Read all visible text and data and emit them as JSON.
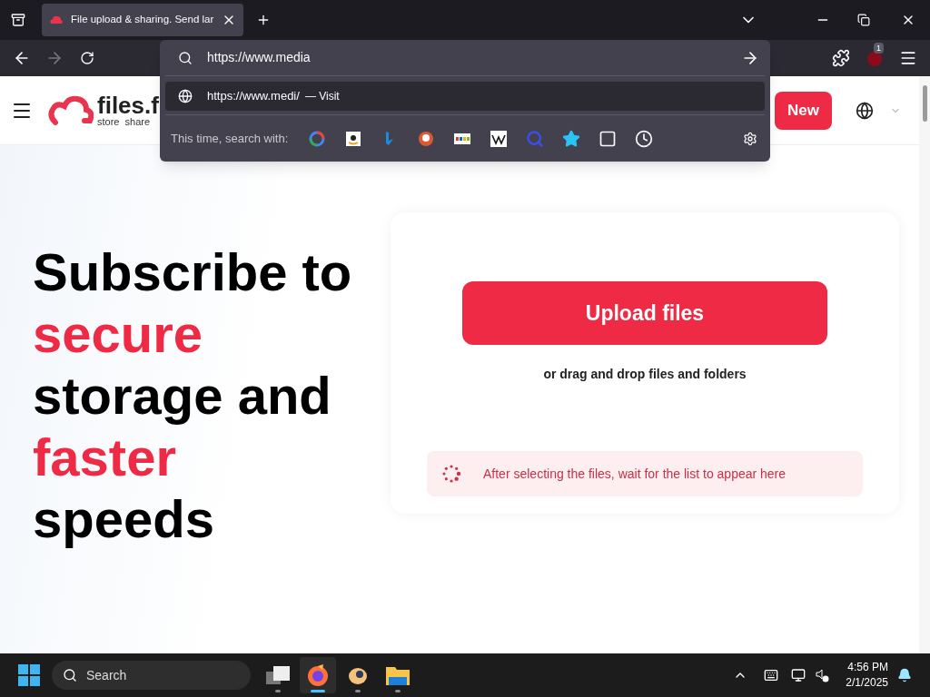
{
  "browser": {
    "tab": {
      "title": "File upload & sharing. Send lar",
      "selected": true
    },
    "address": {
      "value": "https://www.media"
    },
    "suggestion": {
      "url": "https://www.medi/",
      "action": "— Visit"
    },
    "search_with": {
      "label": "This time, search with:"
    },
    "extension_badge": "1"
  },
  "site": {
    "logo": {
      "name": "files.f",
      "tagline": "store  share"
    },
    "new_button": "New",
    "headline": [
      {
        "text": "Subscribe to",
        "highlight": false
      },
      {
        "text": "secure",
        "highlight": true
      },
      {
        "text": "storage and",
        "highlight": false
      },
      {
        "text": "faster",
        "highlight": true
      },
      {
        "text": "speeds",
        "highlight": false
      }
    ],
    "upload_button": "Upload files",
    "drop_hint": "or drag and drop files and folders",
    "status": "After selecting the files, wait for the list to appear here"
  },
  "taskbar": {
    "search": "Search",
    "apps": [
      {
        "kind": "taskview",
        "selected": false
      },
      {
        "kind": "firefox",
        "selected": true
      },
      {
        "kind": "app",
        "selected": false
      },
      {
        "kind": "folder",
        "selected": false
      }
    ],
    "time": "4:56 PM",
    "date": "2/1/2025"
  }
}
